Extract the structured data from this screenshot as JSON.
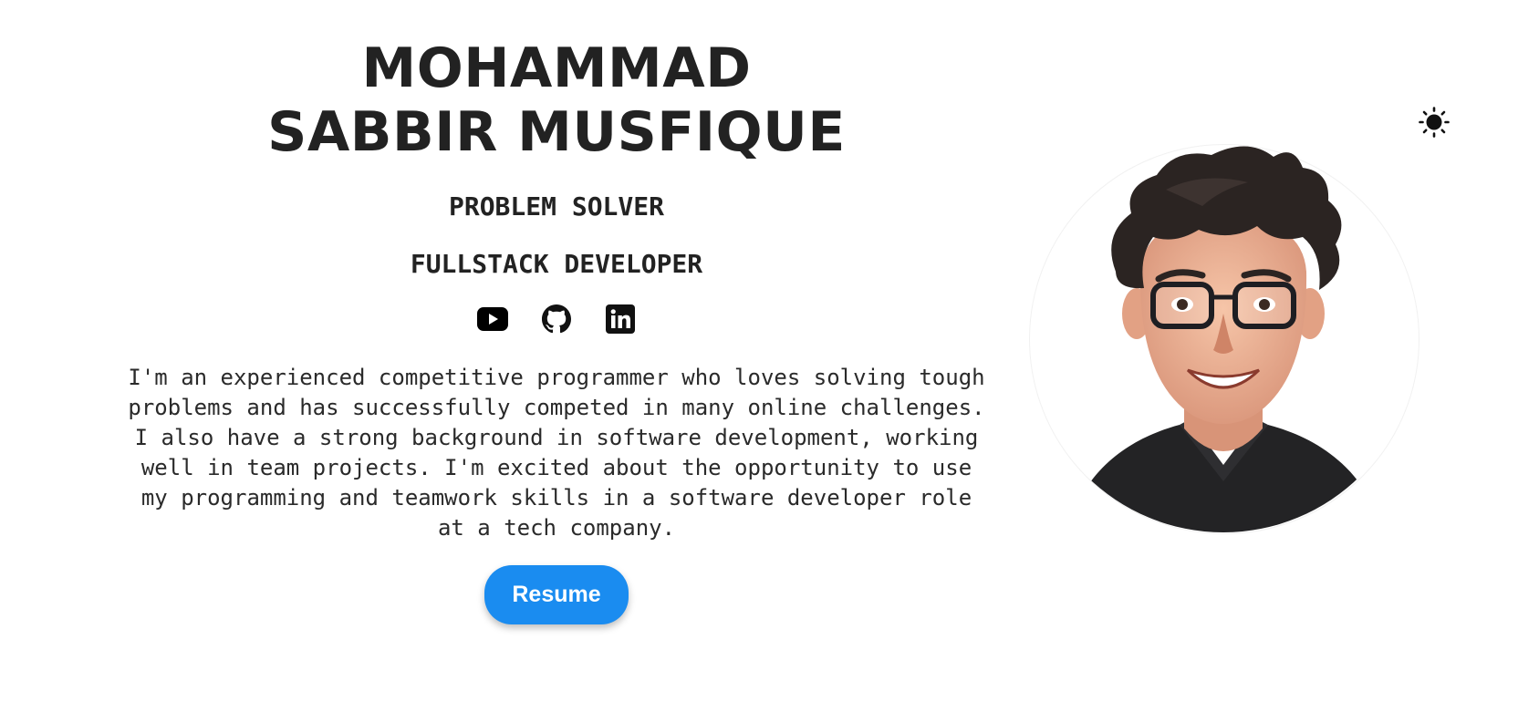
{
  "hero": {
    "name_line1": "MOHAMMAD",
    "name_line2": "SABBIR MUSFIQUE",
    "role1": "PROBLEM SOLVER",
    "role2": "FULLSTACK DEVELOPER",
    "bio": "I'm an experienced competitive programmer who loves solving tough problems and has successfully competed in many online challenges. I also have a strong background in software development, working well in team projects. I'm excited about the opportunity to use my programming and teamwork skills in a software developer role at a tech company.",
    "resume_label": "Resume"
  },
  "socials": [
    {
      "icon": "youtube-icon"
    },
    {
      "icon": "github-icon"
    },
    {
      "icon": "linkedin-icon"
    }
  ],
  "theme_toggle": {
    "icon": "sun-icon"
  },
  "avatar": {
    "icon": "avatar-illustration"
  },
  "colors": {
    "text": "#222222",
    "accent": "#1a8cf0",
    "background": "#ffffff"
  }
}
